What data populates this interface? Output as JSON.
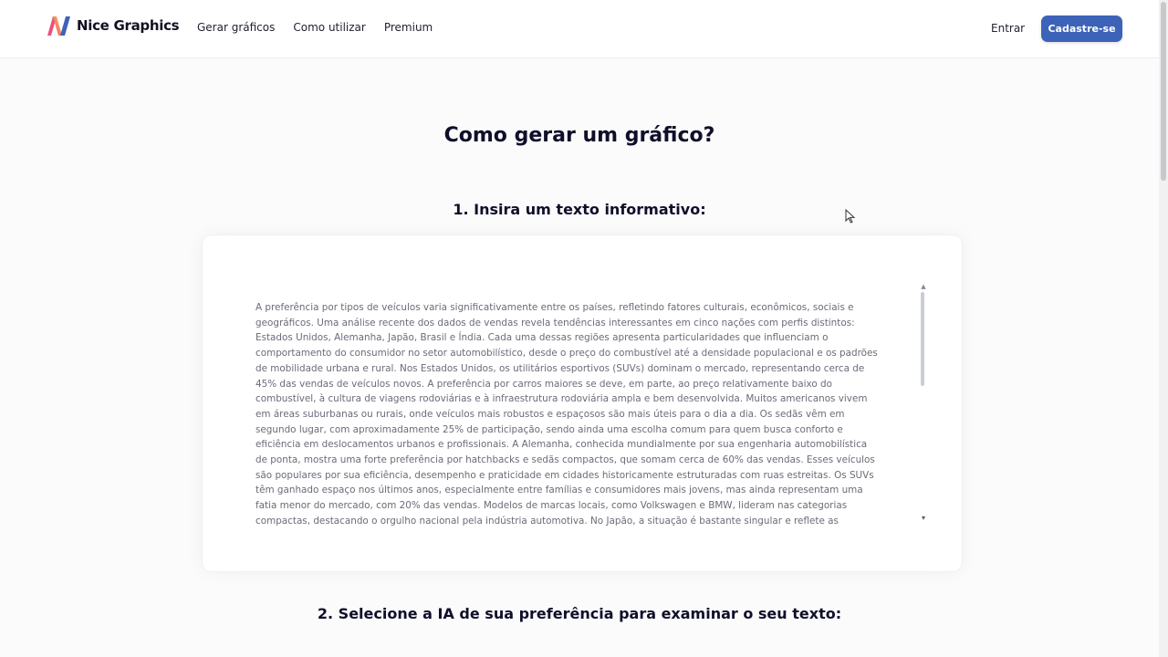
{
  "header": {
    "brand": "Nice Graphics",
    "nav": [
      "Gerar gráficos",
      "Como utilizar",
      "Premium"
    ],
    "login_label": "Entrar",
    "signup_label": "Cadastre-se"
  },
  "main": {
    "title": "Como gerar um gráfico?",
    "step1_title": "1. Insira um texto informativo:",
    "input_text": "A preferência por tipos de veículos varia significativamente entre os países, refletindo fatores culturais, econômicos, sociais e geográficos. Uma análise recente dos dados de vendas revela tendências interessantes em cinco nações com perfis distintos: Estados Unidos, Alemanha, Japão, Brasil e Índia. Cada uma dessas regiões apresenta particularidades que influenciam o comportamento do consumidor no setor automobilístico, desde o preço do combustível até a densidade populacional e os padrões de mobilidade urbana e rural. Nos Estados Unidos, os utilitários esportivos (SUVs) dominam o mercado, representando cerca de 45% das vendas de veículos novos. A preferência por carros maiores se deve, em parte, ao preço relativamente baixo do combustível, à cultura de viagens rodoviárias e à infraestrutura rodoviária ampla e bem desenvolvida. Muitos americanos vivem em áreas suburbanas ou rurais, onde veículos mais robustos e espaçosos são mais úteis para o dia a dia. Os sedãs vêm em segundo lugar, com aproximadamente 25% de participação, sendo ainda uma escolha comum para quem busca conforto e eficiência em deslocamentos urbanos e profissionais. A Alemanha, conhecida mundialmente por sua engenharia automobilística de ponta, mostra uma forte preferência por hatchbacks e sedãs compactos, que somam cerca de 60% das vendas. Esses veículos são populares por sua eficiência, desempenho e praticidade em cidades historicamente estruturadas com ruas estreitas. Os SUVs têm ganhado espaço nos últimos anos, especialmente entre famílias e consumidores mais jovens, mas ainda representam uma fatia menor do mercado, com 20% das vendas. Modelos de marcas locais, como Volkswagen e BMW, lideram nas categorias compactas, destacando o orgulho nacional pela indústria automotiva. No Japão, a situação é bastante singular e reflete as",
    "step2_title": "2. Selecione a IA de sua preferência para examinar o seu texto:"
  },
  "icons": {
    "logo": "logo-icon",
    "scroll_up": "chevron-up-icon",
    "scroll_down": "chevron-down-icon",
    "cursor": "mouse-pointer-icon"
  },
  "colors": {
    "primary": "#3d63b8",
    "logo_blue": "#3d63b8",
    "logo_pink": "#ee4f7a",
    "logo_yellow": "#f6c445"
  }
}
